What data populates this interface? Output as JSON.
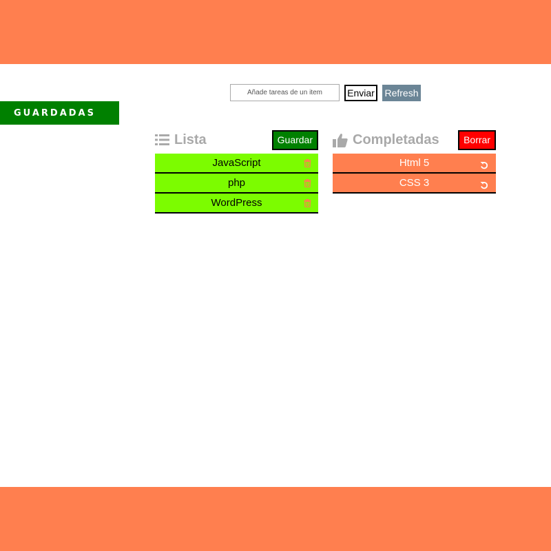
{
  "sidebar": {
    "saved_tab_label": "GUARDADAS"
  },
  "form": {
    "input_placeholder": "Añade tareas de un item",
    "send_label": "Enviar",
    "refresh_label": "Refresh"
  },
  "lista": {
    "title": "Lista",
    "title_icon": "list-icon",
    "save_label": "Guardar",
    "item_action_icon": "trash-icon",
    "items": [
      {
        "label": "JavaScript"
      },
      {
        "label": "php"
      },
      {
        "label": "WordPress"
      }
    ]
  },
  "completadas": {
    "title": "Completadas",
    "title_icon": "thumbs-up-icon",
    "delete_label": "Borrar",
    "item_action_icon": "undo-icon",
    "items": [
      {
        "label": "Html 5"
      },
      {
        "label": "CSS 3"
      }
    ]
  },
  "colors": {
    "header_footer": "#ff7f4f",
    "saved_tab": "#008000",
    "pending_item": "#7cfc00",
    "completed_item": "#ff7f4f",
    "save_button": "#008000",
    "delete_button": "#ff0000",
    "refresh_button": "#6b8596"
  }
}
